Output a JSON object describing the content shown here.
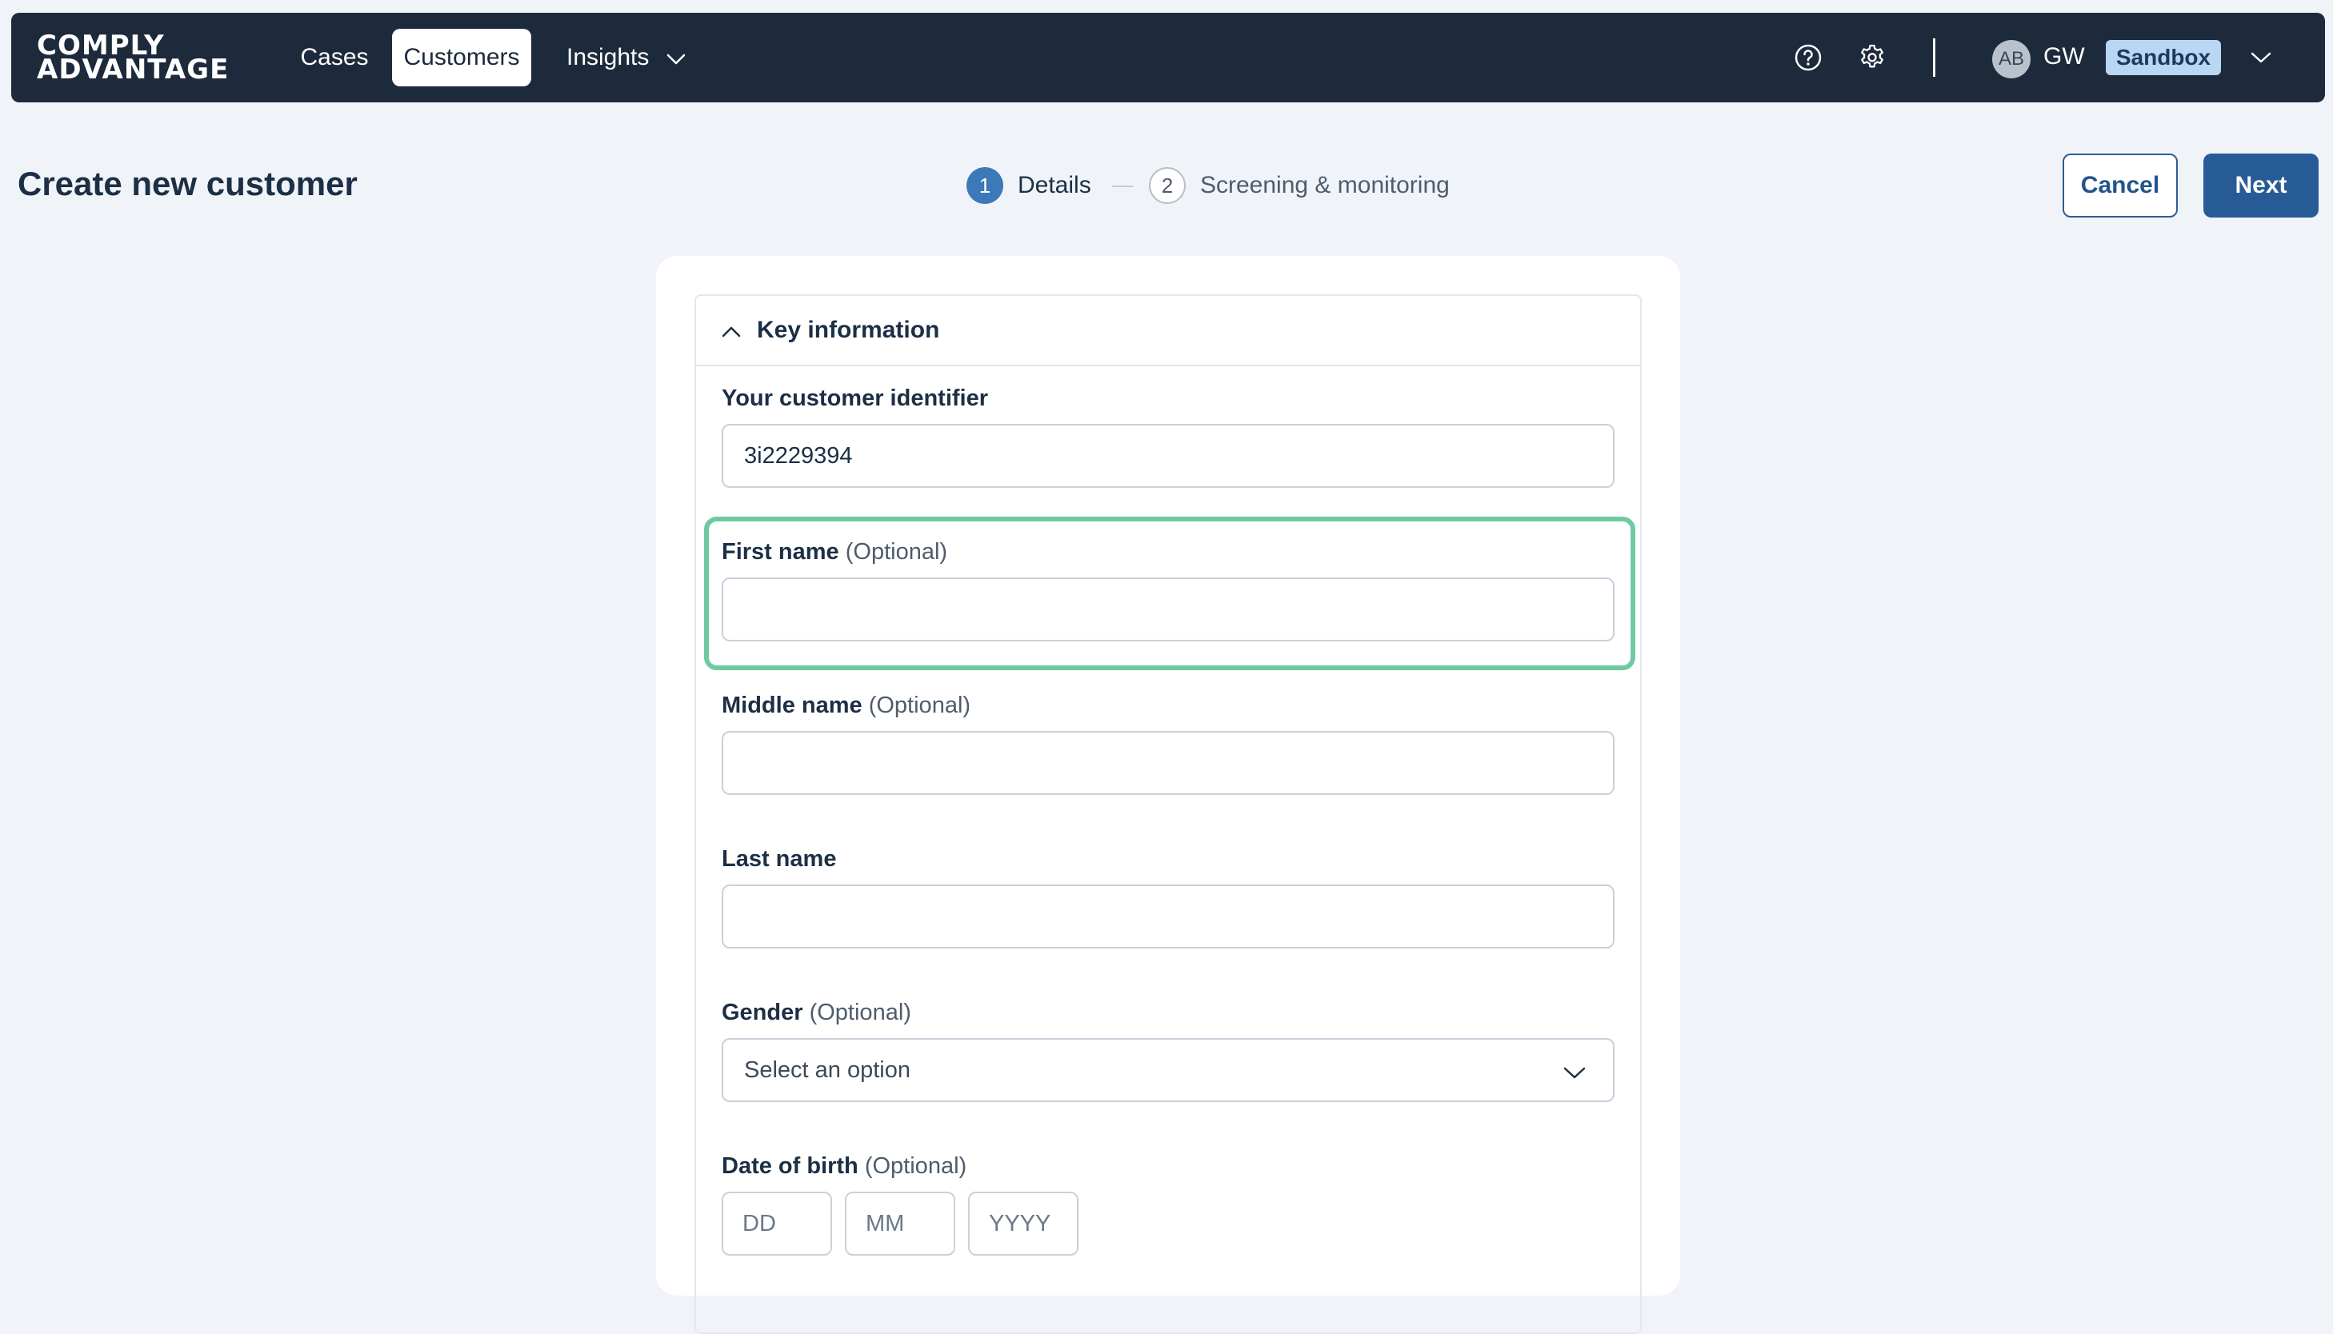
{
  "app": {
    "logo_line1": "COMPLY",
    "logo_line2": "ADVANTAGE"
  },
  "nav": {
    "items": [
      {
        "label": "Cases"
      },
      {
        "label": "Customers",
        "active": true
      },
      {
        "label": "Insights"
      }
    ],
    "icons": [
      "help-circle-icon",
      "gear-icon",
      "chevron-down-icon"
    ]
  },
  "user": {
    "avatar_initials": "AB",
    "initials": "GW",
    "environment": "Sandbox"
  },
  "page": {
    "title": "Create new customer"
  },
  "stepper": {
    "steps": [
      {
        "number": "1",
        "label": "Details",
        "active": true
      },
      {
        "number": "2",
        "label": "Screening & monitoring",
        "active": false
      }
    ]
  },
  "actions": {
    "cancel": "Cancel",
    "next": "Next"
  },
  "form": {
    "section_title": "Key information",
    "customer_id": {
      "label": "Your customer identifier",
      "value": "3i2229394"
    },
    "first_name": {
      "label": "First name",
      "optional": "(Optional)",
      "value": ""
    },
    "middle_name": {
      "label": "Middle name",
      "optional": "(Optional)",
      "value": ""
    },
    "last_name": {
      "label": "Last name",
      "value": ""
    },
    "gender": {
      "label": "Gender",
      "optional": "(Optional)",
      "placeholder": "Select an option"
    },
    "dob": {
      "label": "Date of birth",
      "optional": "(Optional)",
      "day_placeholder": "DD",
      "month_placeholder": "MM",
      "year_placeholder": "YYYY"
    }
  },
  "colors": {
    "topbar": "#1c2a3b",
    "primary": "#265b96",
    "focus_ring": "#6fcaa0",
    "badge": "#b9d6f2"
  }
}
